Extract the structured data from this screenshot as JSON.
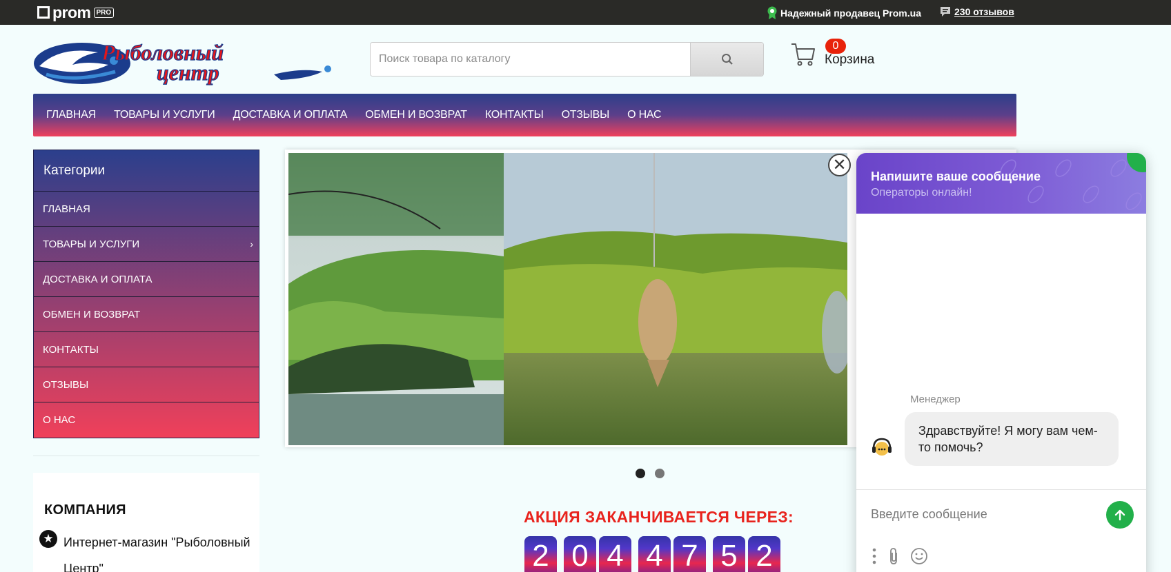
{
  "topbar": {
    "brand": "prom",
    "brand_badge": "PRO",
    "trusted_seller": "Надежный продавец Prom.ua",
    "reviews_link": "230 отзывов"
  },
  "header": {
    "logo_alt": "Рыболовный центр",
    "search_placeholder": "Поиск товара по каталогу",
    "cart_count": "0",
    "cart_label": "Корзина"
  },
  "nav": {
    "items": [
      "ГЛАВНАЯ",
      "ТОВАРЫ И УСЛУГИ",
      "ДОСТАВКА И ОПЛАТА",
      "ОБМЕН И ВОЗВРАТ",
      "КОНТАКТЫ",
      "ОТЗЫВЫ",
      "О НАС"
    ]
  },
  "sidebar": {
    "title": "Категории",
    "items": [
      "ГЛАВНАЯ",
      "ТОВАРЫ И УСЛУГИ",
      "ДОСТАВКА И ОПЛАТА",
      "ОБМЕН И ВОЗВРАТ",
      "КОНТАКТЫ",
      "ОТЗЫВЫ",
      "О НАС"
    ],
    "chevron": "›"
  },
  "company": {
    "heading": "КОМПАНИЯ",
    "name": "Интернет-магазин \"Рыболовный Центр\""
  },
  "promo": {
    "title": "АКЦИЯ ЗАКАНЧИВАЕТСЯ ЧЕРЕЗ:",
    "digits": [
      "2",
      "0",
      "4",
      "4",
      "7",
      "5",
      "2"
    ]
  },
  "banner": {
    "slide_count": 2,
    "active_slide": 1,
    "close_symbol": "✕"
  },
  "chat": {
    "title": "Напишите ваше сообщение",
    "subtitle": "Операторы онлайн!",
    "sender": "Менеджер",
    "message": "Здравствуйте! Я могу вам чем-то помочь?",
    "input_placeholder": "Введите сообщение",
    "accent": "#22b04a",
    "header_color": "#6a44c9"
  },
  "colors": {
    "nav_top": "#2c3f8a",
    "nav_bottom": "#f0415c",
    "promo_red": "#e8231d",
    "cart_badge": "#e8220a"
  }
}
